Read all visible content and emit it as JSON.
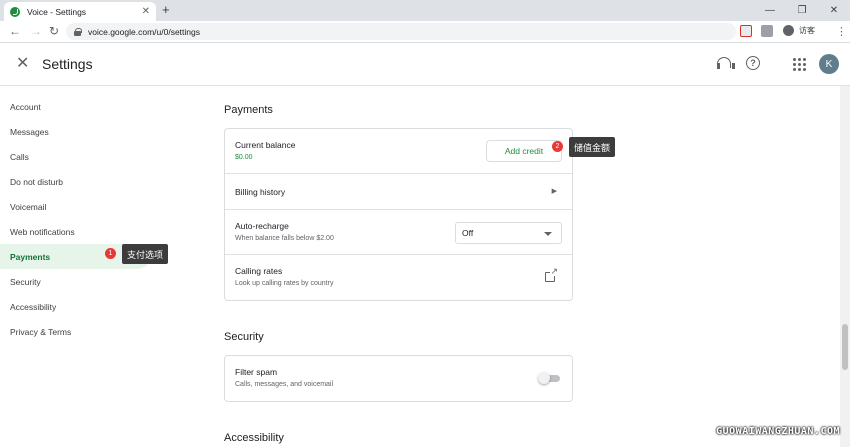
{
  "browser": {
    "tab_title": "Voice - Settings",
    "tab_close": "✕",
    "new_tab": "+",
    "url": "voice.google.com/u/0/settings",
    "profile_label": "访客",
    "window_controls": [
      "—",
      "❐",
      "✕"
    ]
  },
  "header": {
    "title": "Settings",
    "close_glyph": "✕",
    "avatar_initial": "K"
  },
  "sidebar": {
    "items": [
      {
        "label": "Account"
      },
      {
        "label": "Messages"
      },
      {
        "label": "Calls"
      },
      {
        "label": "Do not disturb"
      },
      {
        "label": "Voicemail"
      },
      {
        "label": "Web notifications"
      },
      {
        "label": "Payments",
        "active": true
      },
      {
        "label": "Security"
      },
      {
        "label": "Accessibility"
      },
      {
        "label": "Privacy & Terms"
      }
    ]
  },
  "payments": {
    "title": "Payments",
    "balance_title": "Current balance",
    "balance_value": "$0.00",
    "add_credit": "Add credit",
    "billing_history": "Billing history",
    "auto_recharge_title": "Auto-recharge",
    "auto_recharge_sub": "When balance falls below $2.00",
    "auto_recharge_value": "Off",
    "calling_rates_title": "Calling rates",
    "calling_rates_sub": "Look up calling rates by country"
  },
  "security": {
    "title": "Security",
    "filter_spam_title": "Filter spam",
    "filter_spam_sub": "Calls, messages, and voicemail",
    "filter_spam_on": false
  },
  "accessibility": {
    "title": "Accessibility"
  },
  "annotations": {
    "badge1": "1",
    "callout1": "支付选项",
    "badge2": "2",
    "callout2": "储值金额"
  },
  "watermark": "GUOWAIWANGZHUAN.COM",
  "colors": {
    "accent_green": "#1e8e3e",
    "active_bg": "#e6f4ea",
    "badge_red": "#e53935",
    "callout_bg": "#3c3c3c"
  }
}
